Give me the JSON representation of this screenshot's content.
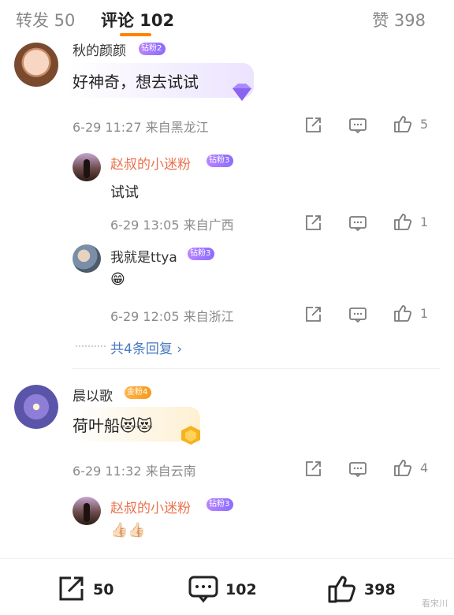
{
  "tabs": {
    "repost": "转发 50",
    "comment": "评论 102",
    "like": "赞 398"
  },
  "comments": [
    {
      "user": "秋的颜颜",
      "badge": "钻粉2",
      "text": "好神奇，想去试试",
      "meta": "6-29 11:27  来自黑龙江",
      "likes": "5"
    },
    {
      "user": "赵叔的小迷粉",
      "badge": "钻粉3",
      "text": "试试",
      "meta": "6-29 13:05  来自广西",
      "likes": "1"
    },
    {
      "user": "我就是ttya",
      "badge": "钻粉3",
      "text": "😁",
      "meta": "6-29 12:05  来自浙江",
      "likes": "1"
    },
    {
      "user": "晨以歌",
      "badge": "金粉4",
      "text": "荷叶船😻😻",
      "meta": "6-29 11:32  来自云南",
      "likes": "4"
    },
    {
      "user": "赵叔的小迷粉",
      "badge": "钻粉3",
      "text": "👍🏻👍🏻",
      "meta": "",
      "likes": ""
    }
  ],
  "more_replies": "共4条回复 ›",
  "bottom": {
    "repost_count": "50",
    "comment_count": "102",
    "like_count": "398"
  },
  "watermark": "看宋川",
  "colors": {
    "accent": "#ff8200",
    "link": "#4a7ac2",
    "username_highlight": "#eb7350"
  }
}
